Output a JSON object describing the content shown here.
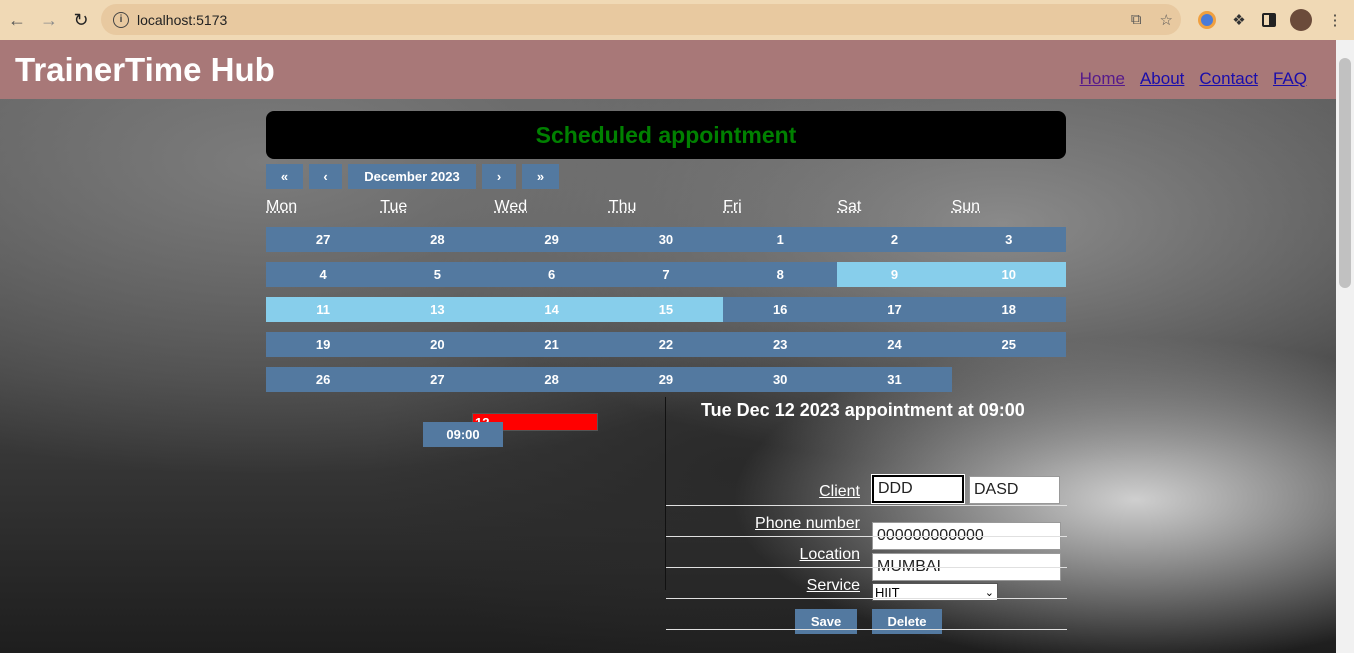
{
  "browser": {
    "url": "localhost:5173",
    "back_icon": "arrow-left-icon",
    "forward_icon": "arrow-right-icon",
    "reload_icon": "reload-icon"
  },
  "header": {
    "brand": "TrainerTime Hub",
    "nav": [
      "Home",
      "About",
      "Contact",
      "FAQ"
    ]
  },
  "banner": {
    "title": "Scheduled appointment",
    "color": "#008000"
  },
  "calendar": {
    "nav": {
      "prev_year": "«",
      "prev_month": "‹",
      "label": "December 2023",
      "next_month": "›",
      "next_year": "»"
    },
    "weekdays": [
      "Mon",
      "Tue",
      "Wed",
      "Thu",
      "Fri",
      "Sat",
      "Sun"
    ],
    "days": [
      "27",
      "28",
      "29",
      "30",
      "1",
      "2",
      "3",
      "4",
      "5",
      "6",
      "7",
      "8",
      "9",
      "10",
      "11",
      "12",
      "13",
      "14",
      "15",
      "16",
      "17",
      "18",
      "19",
      "20",
      "21",
      "22",
      "23",
      "24",
      "25",
      "26",
      "27",
      "28",
      "29",
      "30",
      "31"
    ],
    "highlighted_days": [
      "9",
      "10",
      "11",
      "13",
      "14",
      "15"
    ],
    "selected_day": "12",
    "colors": {
      "day": "#5379a0",
      "highlight": "#87ceeb",
      "selected": "#ff0000"
    }
  },
  "time_slot": "09:00",
  "appointment": {
    "title": "Tue Dec 12 2023  appointment at 09:00",
    "client_label": "Client",
    "first_name": "DDD",
    "last_name": "DASD",
    "phone_label": "Phone number",
    "phone": "000000000000",
    "location_label": "Location",
    "location": "MUMBAI",
    "service_label": "Service",
    "service": "HIIT",
    "save": "Save",
    "delete": "Delete"
  }
}
